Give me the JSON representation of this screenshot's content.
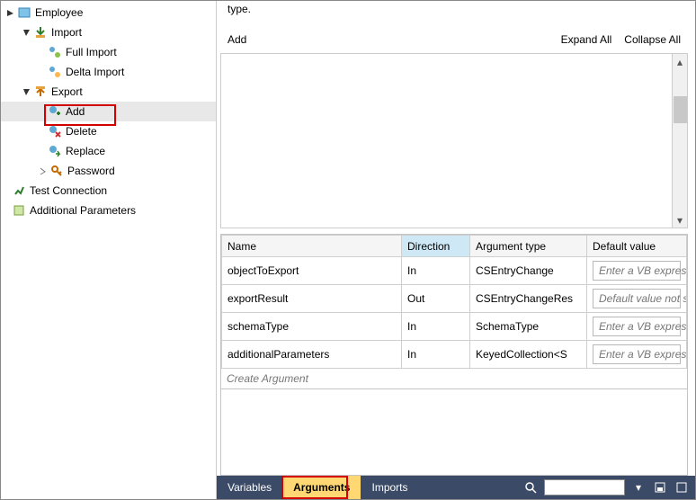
{
  "tree": {
    "root": "Employee",
    "import": {
      "label": "Import",
      "full": "Full Import",
      "delta": "Delta Import"
    },
    "export": {
      "label": "Export",
      "add": "Add",
      "delete": "Delete",
      "replace": "Replace",
      "password": "Password"
    },
    "testConn": "Test Connection",
    "addlParams": "Additional Parameters"
  },
  "right": {
    "topText": "type.",
    "add": "Add",
    "expandAll": "Expand All",
    "collapseAll": "Collapse All"
  },
  "argTable": {
    "headers": {
      "name": "Name",
      "direction": "Direction",
      "argType": "Argument type",
      "defVal": "Default value"
    },
    "rows": [
      {
        "name": "objectToExport",
        "direction": "In",
        "argType": "CSEntryChange",
        "defVal": "Enter a VB expression"
      },
      {
        "name": "exportResult",
        "direction": "Out",
        "argType": "CSEntryChangeRes",
        "defVal": "Default value not suppor"
      },
      {
        "name": "schemaType",
        "direction": "In",
        "argType": "SchemaType",
        "defVal": "Enter a VB expression"
      },
      {
        "name": "additionalParameters",
        "direction": "In",
        "argType": "KeyedCollection<S",
        "defVal": "Enter a VB expression"
      }
    ],
    "createArg": "Create Argument"
  },
  "tabs": {
    "variables": "Variables",
    "arguments": "Arguments",
    "imports": "Imports"
  }
}
